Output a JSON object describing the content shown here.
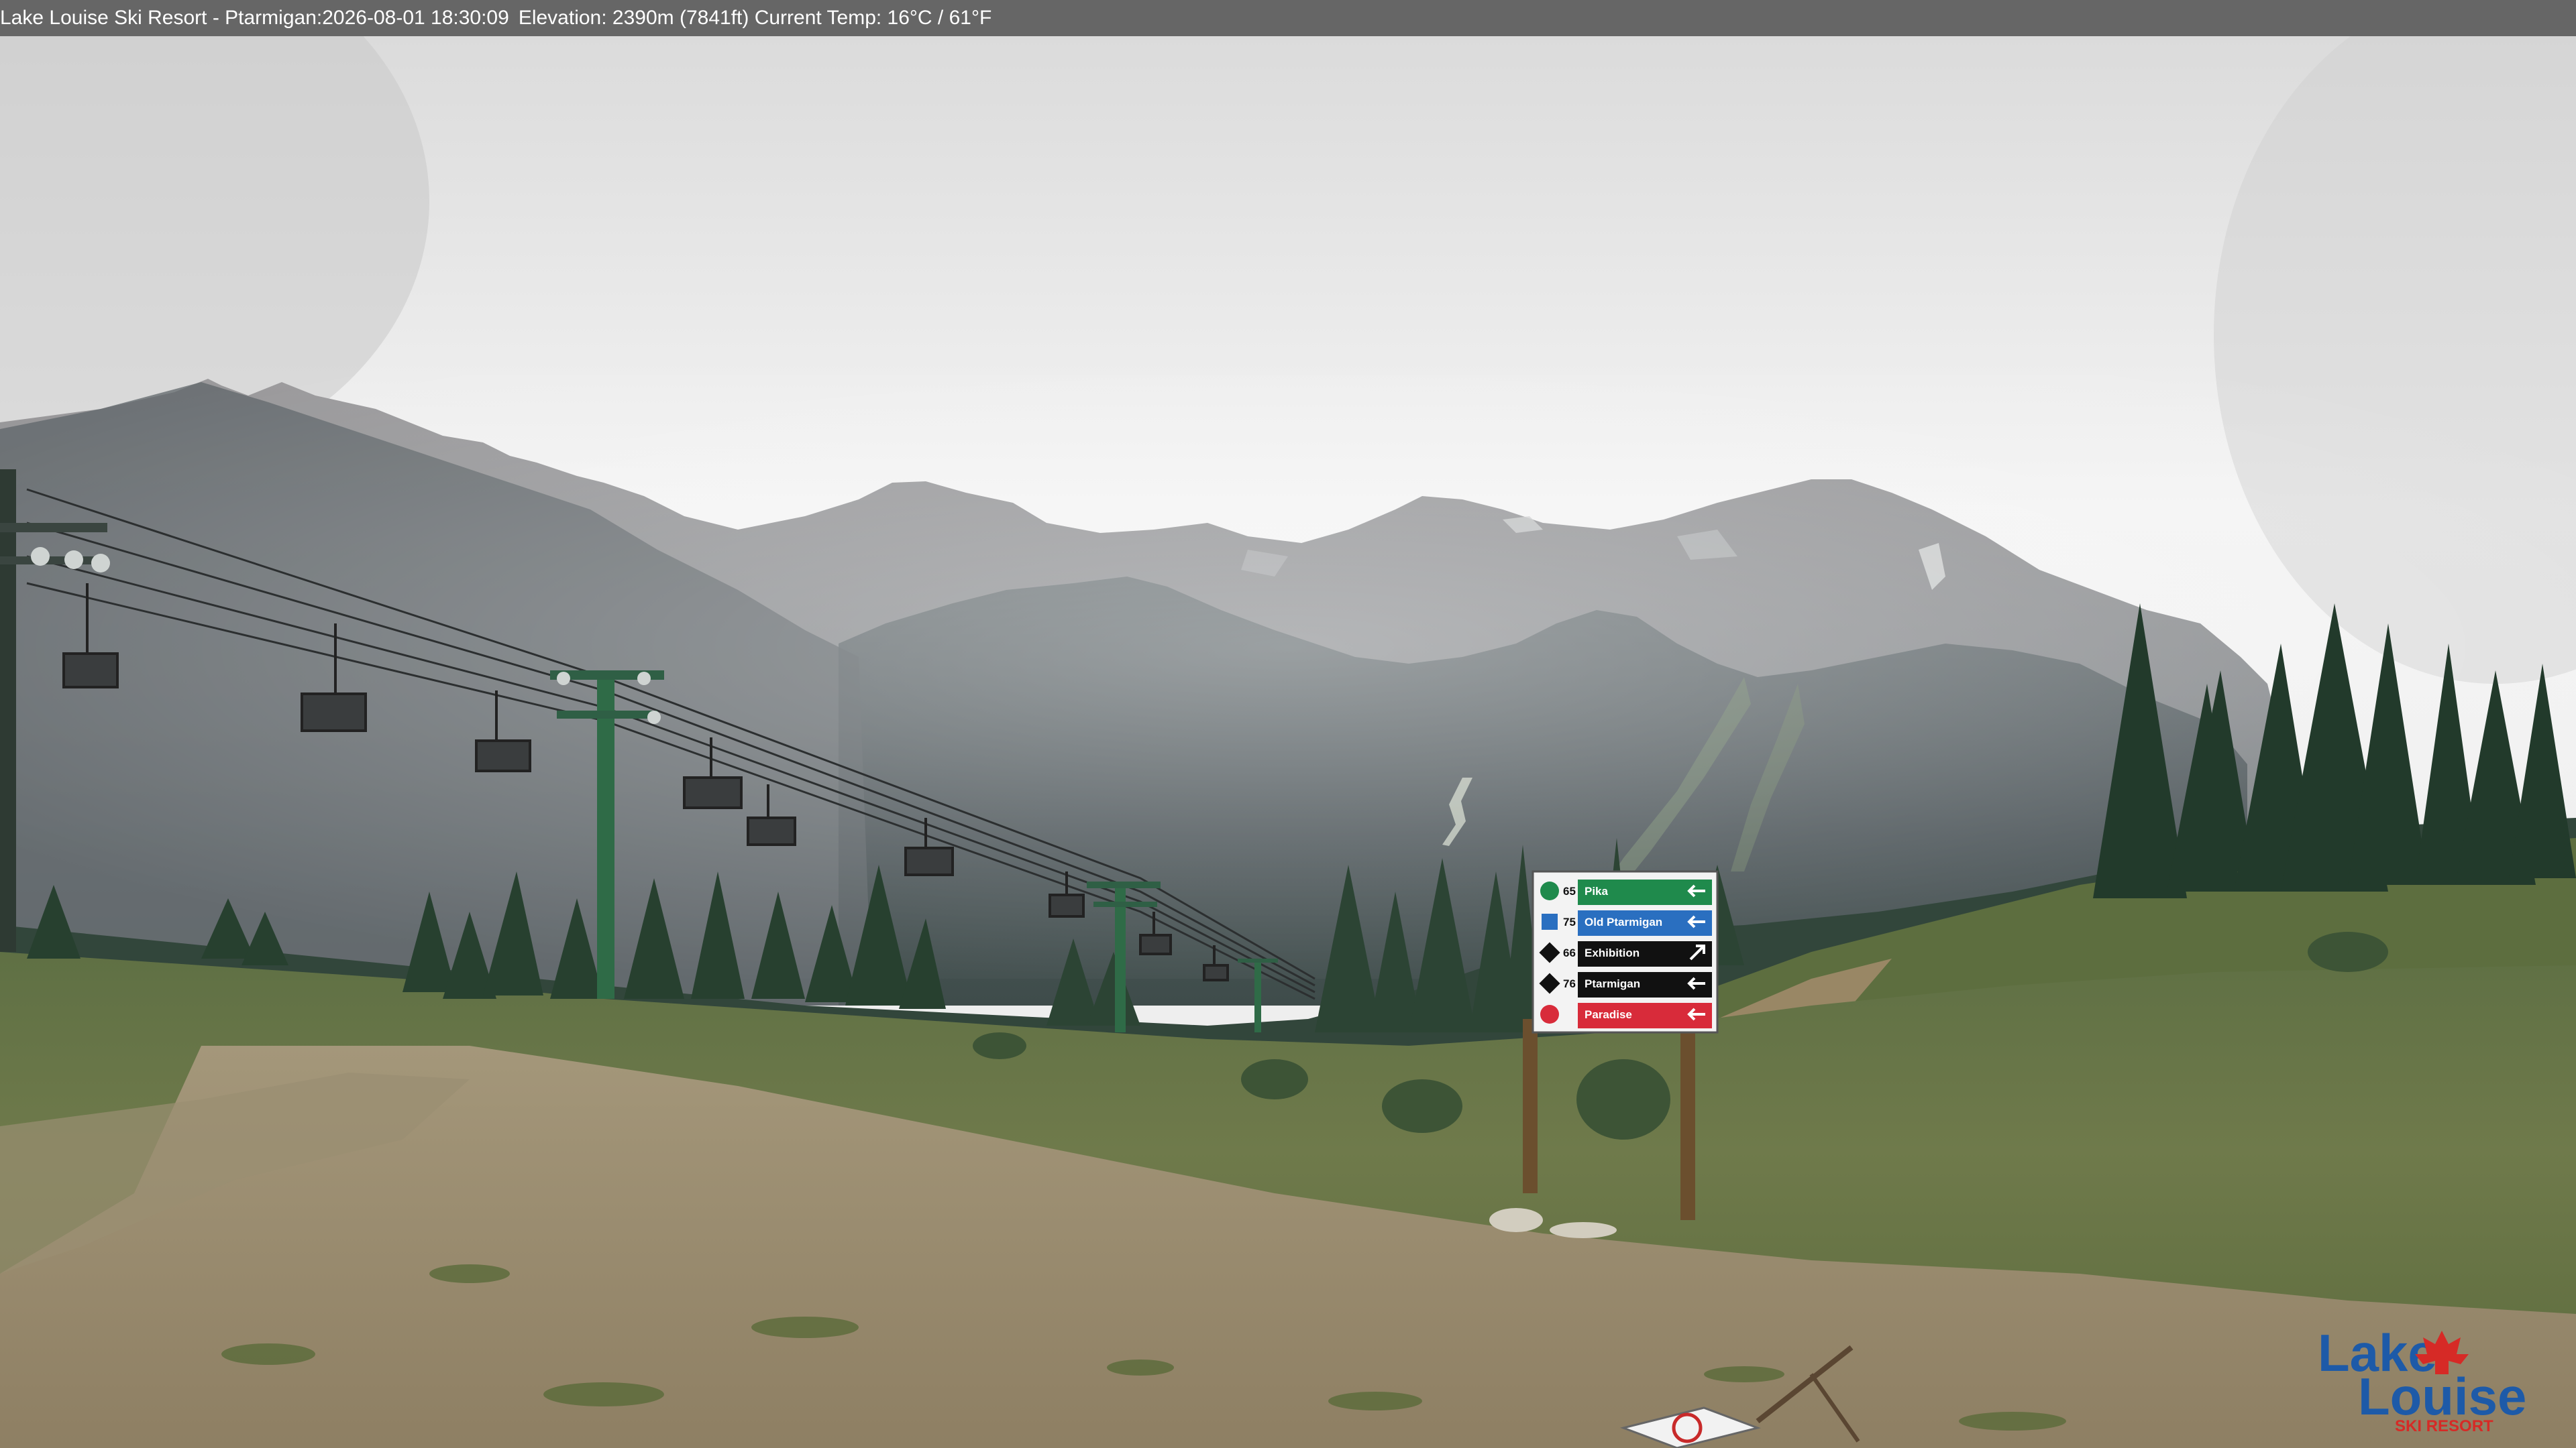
{
  "header": {
    "resort": "Lake Louise Ski Resort - Ptarmigan",
    "datetime": "2026-08-01 18:30:09",
    "elevation": "Elevation: 2390m (7841ft)",
    "temperature": "Current Temp: 16°C / 61°F"
  },
  "signpost": {
    "trails": [
      {
        "number": "65",
        "name": "Pika",
        "difficulty": "green-circle",
        "arrow": "left",
        "color": "#1f8a4c"
      },
      {
        "number": "75",
        "name": "Old Ptarmigan",
        "difficulty": "blue-square",
        "arrow": "left",
        "color": "#2a6fc0"
      },
      {
        "number": "66",
        "name": "Exhibition",
        "difficulty": "double-black-diamond",
        "arrow": "up-right",
        "color": "#111111"
      },
      {
        "number": "76",
        "name": "Ptarmigan",
        "difficulty": "black-diamond",
        "arrow": "left",
        "color": "#111111"
      },
      {
        "number": "",
        "name": "Paradise",
        "difficulty": "chairlift",
        "arrow": "left",
        "color": "#d82b3a"
      }
    ]
  },
  "logo": {
    "line1": "Lake",
    "line2": "Louise",
    "line3": "SKI RESORT",
    "brand_color": "#1d5aa8",
    "leaf_color": "#d62a26"
  },
  "colors": {
    "sky": "#eeeeee",
    "mountain_far": "#8e8f92",
    "mountain_near": "#4d5558",
    "forest": "#2f4a3a",
    "meadow": "#6d7a45",
    "dirt": "#9a8c70"
  }
}
